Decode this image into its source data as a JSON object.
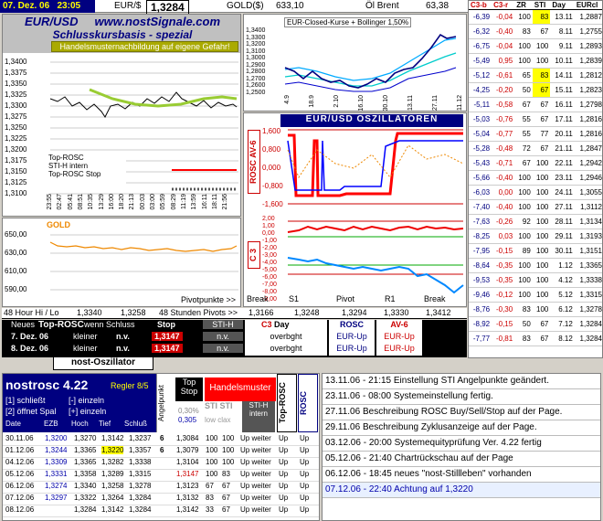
{
  "header": {
    "date": "07. Dez. 06",
    "time": "23:05",
    "eur_label": "EUR/$",
    "eur_value": "1,3284",
    "gold_label": "GOLD($)",
    "gold_value": "633,10",
    "oil_label": "Öl Brent",
    "oil_value": "63,38"
  },
  "main_chart": {
    "title1": "EUR/USD",
    "title2": "www.nostSignale.com",
    "title3": "Schlusskursbasis - spezial",
    "warning": "Handelsmusternachbildung auf eigene Gefahr!",
    "y_ticks": [
      "1,3400",
      "1,3375",
      "1,3350",
      "1,3325",
      "1,3300",
      "1,3275",
      "1,3250",
      "1,3225",
      "1,3200",
      "1,3175",
      "1,3150",
      "1,3125",
      "1,3100"
    ],
    "x_ticks": [
      "23:55",
      "02:47",
      "05:41",
      "08:51",
      "10:35",
      "13:29",
      "16:00",
      "18:20",
      "21:13",
      "00:03",
      "03:00",
      "05:59",
      "08:29",
      "11:19",
      "13:59",
      "16:11",
      "18:11",
      "21:56"
    ],
    "legend": [
      "Top-ROSC",
      "STI-H intern",
      "Top-ROSC Stop"
    ]
  },
  "gold_chart": {
    "title": "GOLD",
    "y_ticks": [
      "650,00",
      "630,00",
      "610,00",
      "590,00"
    ],
    "footer": "Pivotpunkte >>"
  },
  "bollinger": {
    "title": "EUR-Closed-Kurse + Bollinger 1,50%",
    "y_ticks": [
      "1,3400",
      "1,3300",
      "1,3200",
      "1,3100",
      "1,3000",
      "1,2900",
      "1,2800",
      "1,2700",
      "1,2600",
      "1,2500"
    ],
    "x_ticks": [
      "4.9",
      "18.9",
      "2.10",
      "16.10",
      "30.10",
      "13.11",
      "27.11",
      "11.12"
    ]
  },
  "osc": {
    "title": "EUR/USD  OSZILLATOREN",
    "side1": "ROSC AV-6",
    "side2": "C 3",
    "y1": [
      "1,600",
      "0,800",
      "0,000",
      "-0,800",
      "-1,600"
    ],
    "y2": [
      "2,00",
      "1,00",
      "0,00",
      "-1,00",
      "-2,00",
      "-3,00",
      "-4,00",
      "-5,00",
      "-6,00",
      "-7,00",
      "-8,00",
      "-9,00"
    ]
  },
  "pivots": {
    "labels": [
      "Break",
      "S1",
      "Pivot",
      "R1",
      "Break"
    ],
    "values": [
      "1,3166",
      "1,3248",
      "1,3294",
      "1,3330",
      "1,3412"
    ],
    "left_label": "48 Hour Hi / Lo",
    "hi": "1,3340",
    "lo": "1,3258",
    "right_label": "48 Stunden Pivots >>"
  },
  "signal_table": {
    "h1": "Neues",
    "h2": "Top-ROSC",
    "h3": "wenn Schluss",
    "h4": "Stop",
    "h5": "STI-H",
    "h6": "C3",
    "h7": "Day",
    "h8": "ROSC",
    "h9": "AV-6",
    "rows": [
      {
        "date": "7. Dez. 06",
        "cond": "kleiner",
        "val": "n.v.",
        "stop": "1,3147",
        "sti": "n.v.",
        "c3": "overbght",
        "rosc": "EUR-Up",
        "av6": "EUR-Up"
      },
      {
        "date": "8. Dez. 06",
        "cond": "kleiner",
        "val": "n.v.",
        "stop": "1,3147",
        "sti": "n.v.",
        "c3": "overbght",
        "rosc": "EUR-Up",
        "av6": "EUR-Up"
      }
    ]
  },
  "tab": {
    "label": "nost-Oszillator"
  },
  "bottom": {
    "title": "nostrosc 4.22",
    "regler": "Regler 8/5",
    "opt1": "[1] schließt",
    "opt1b": "[-] einzeln",
    "opt2": "[2] öffnet Spal",
    "opt2b": "[+] einzeln",
    "cols": [
      "Date",
      "EZB",
      "Hoch",
      "Tief",
      "Schluß"
    ],
    "v_angel": "Angelpunkt",
    "top_stop": "Top Stop",
    "handels": "Handelsmuster",
    "v030": "0,30%",
    "v0305": "0,305",
    "sti": "STI STI",
    "lowclax": "low clax",
    "sti_h": "STI-H intern",
    "top_rosc": "Top-ROSC",
    "rosc": "ROSC",
    "rows": [
      [
        "30.11.06",
        "1,3200",
        "1,3270",
        "1,3142",
        "1,3237",
        "6",
        "1,3084",
        "100",
        "100",
        "Up weiter",
        "Up",
        "Up"
      ],
      [
        "01.12.06",
        "1,3244",
        "1,3365",
        "1,3220",
        "1,3357",
        "6",
        "1,3079",
        "100",
        "100",
        "Up weiter",
        "Up",
        "Up"
      ],
      [
        "04.12.06",
        "1,3309",
        "1,3365",
        "1,3282",
        "1,3338",
        "",
        "1,3104",
        "100",
        "100",
        "Up weiter",
        "Up",
        "Up"
      ],
      [
        "05.12.06",
        "1,3331",
        "1,3358",
        "1,3289",
        "1,3315",
        "",
        "1,3147",
        "100",
        "83",
        "Up weiter",
        "Up",
        "Up"
      ],
      [
        "06.12.06",
        "1,3274",
        "1,3340",
        "1,3258",
        "1,3278",
        "",
        "1,3123",
        "67",
        "67",
        "Up weiter",
        "Up",
        "Up"
      ],
      [
        "07.12.06",
        "1,3297",
        "1,3322",
        "1,3264",
        "1,3284",
        "",
        "1,3132",
        "83",
        "67",
        "Up weiter",
        "Up",
        "Up"
      ],
      [
        "08.12.06",
        "",
        "1,3284",
        "1,3142",
        "1,3284",
        "",
        "1,3142",
        "33",
        "67",
        "Up weiter",
        "Up",
        "Up"
      ]
    ]
  },
  "log": [
    "13.11.06 - 21:15 Einstellung STI Angelpunkte geändert.",
    "23.11.06 - 08:00 Systemeinstellung fertig.",
    "27.11.06 Beschreibung ROSC Buy/Sell/Stop auf der Page.",
    "29.11.06 Beschreibung Zyklusanzeige auf der Page.",
    "03.12.06 - 20:00 Systemequityprüfung Ver. 4.22 fertig",
    "05.12.06 - 21:40 Chartrückschau auf der Page",
    "06.12.06 - 18:45 neues \"nost-Stillleben\" vorhanden",
    "07.12.06 - 22:40 Achtung auf 1,3220"
  ],
  "right_table": {
    "cols": [
      "C3-b",
      "C3-r",
      "ZR",
      "STI",
      "Day",
      "EURcl"
    ],
    "rows": [
      [
        "-6,39",
        "-0,04",
        "100",
        "83",
        "13.11",
        "1,2887"
      ],
      [
        "-6,32",
        "-0,40",
        "83",
        "67",
        "8.11",
        "1,2755"
      ],
      [
        "-6,75",
        "-0,04",
        "100",
        "100",
        "9.11",
        "1,2893"
      ],
      [
        "-5,49",
        "0,95",
        "100",
        "100",
        "10.11",
        "1,2839"
      ],
      [
        "-5,12",
        "-0,61",
        "65",
        "83",
        "14.11",
        "1,2812"
      ],
      [
        "-4,25",
        "-0,20",
        "50",
        "67",
        "15.11",
        "1,2823"
      ],
      [
        "-5,11",
        "-0,58",
        "67",
        "67",
        "16.11",
        "1,2798"
      ],
      [
        "-5,03",
        "-0,76",
        "55",
        "67",
        "17.11",
        "1,2816"
      ],
      [
        "-5,04",
        "-0,77",
        "55",
        "77",
        "20.11",
        "1,2816"
      ],
      [
        "-5,28",
        "-0,48",
        "72",
        "67",
        "21.11",
        "1,2847"
      ],
      [
        "-5,43",
        "-0,71",
        "67",
        "100",
        "22.11",
        "1,2942"
      ],
      [
        "-5,66",
        "-0,40",
        "100",
        "100",
        "23.11",
        "1,2946"
      ],
      [
        "-6,03",
        "0,00",
        "100",
        "100",
        "24.11",
        "1,3055"
      ],
      [
        "-7,40",
        "-0,40",
        "100",
        "100",
        "27.11",
        "1,3112"
      ],
      [
        "-7,63",
        "-0,26",
        "92",
        "100",
        "28.11",
        "1,3134"
      ],
      [
        "-8,25",
        "0,03",
        "100",
        "100",
        "29.11",
        "1,3193"
      ],
      [
        "-7,95",
        "-0,15",
        "89",
        "100",
        "30.11",
        "1,3151"
      ],
      [
        "-8,64",
        "-0,35",
        "100",
        "100",
        "1.12",
        "1,3365"
      ],
      [
        "-9,53",
        "-0,35",
        "100",
        "100",
        "4.12",
        "1,3338"
      ],
      [
        "-9,46",
        "-0,12",
        "100",
        "100",
        "5.12",
        "1,3315"
      ],
      [
        "-8,76",
        "-0,30",
        "83",
        "100",
        "6.12",
        "1,3278"
      ],
      [
        "-8,92",
        "-0,15",
        "50",
        "67",
        "7.12",
        "1,3284"
      ],
      [
        "-7,77",
        "-0,81",
        "83",
        "67",
        "8.12",
        "1,3284"
      ]
    ]
  },
  "colors": {
    "navy": "#000080",
    "yellow": "#ffff00",
    "red": "#ff0000",
    "green": "#008000"
  }
}
